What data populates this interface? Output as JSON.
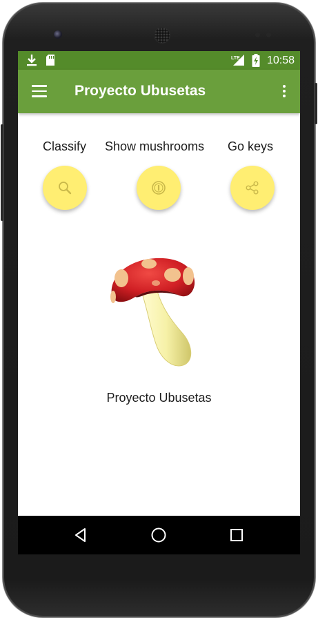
{
  "status_bar": {
    "time": "10:58",
    "network": "LTE",
    "icons": [
      "download-icon",
      "sd-card-icon",
      "lte-signal-icon",
      "battery-charging-icon"
    ]
  },
  "app_bar": {
    "title": "Proyecto Ubusetas",
    "menu_icon": "hamburger-menu-icon",
    "overflow_icon": "more-vert-icon"
  },
  "actions": [
    {
      "label": "Classify",
      "icon": "magnifier-icon"
    },
    {
      "label": "Show mushrooms",
      "icon": "info-icon"
    },
    {
      "label": "Go keys",
      "icon": "share-icon"
    }
  ],
  "main": {
    "image": "mushroom-illustration",
    "caption": "Proyecto Ubusetas"
  },
  "nav_bar": {
    "icons": [
      "back-triangle-icon",
      "home-circle-icon",
      "recents-square-icon"
    ]
  },
  "colors": {
    "status_bar": "#548b2a",
    "app_bar": "#6a9f3c",
    "fab": "#ffee72",
    "mushroom_cap": "#d01f24",
    "mushroom_stem": "#f6f1a7"
  }
}
